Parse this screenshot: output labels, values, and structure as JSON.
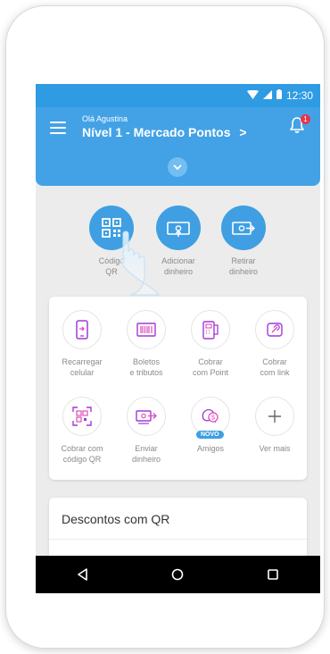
{
  "status_bar": {
    "time": "12:30"
  },
  "header": {
    "greeting": "Olá Agustina",
    "level": "Nível 1 - Mercado Pontos",
    "level_chevron": ">",
    "notification_count": "1"
  },
  "actions": [
    {
      "label": "Código\nQR",
      "icon": "qr-code-icon"
    },
    {
      "label": "Adicionar\ndinheiro",
      "icon": "add-money-icon"
    },
    {
      "label": "Retirar\ndinheiro",
      "icon": "withdraw-money-icon"
    }
  ],
  "services": [
    {
      "label": "Recarregar\ncelular",
      "icon": "phone-recharge-icon"
    },
    {
      "label": "Boletos\ne tributos",
      "icon": "barcode-icon"
    },
    {
      "label": "Cobrar\ncom Point",
      "icon": "point-device-icon"
    },
    {
      "label": "Cobrar\ncom link",
      "icon": "link-icon"
    },
    {
      "label": "Cobrar com\ncódigo QR",
      "icon": "qr-scan-icon"
    },
    {
      "label": "Enviar\ndinheiro",
      "icon": "send-money-icon"
    },
    {
      "label": "Amigos",
      "icon": "friends-money-icon",
      "badge": "NOVO"
    },
    {
      "label": "Ver mais",
      "icon": "plus-icon"
    }
  ],
  "discounts": {
    "title": "Descontos com QR"
  },
  "colors": {
    "primary": "#43a2e6",
    "badge": "#e8334a",
    "accent_purple": "#a13ad6",
    "accent_pink": "#e04cbb"
  }
}
